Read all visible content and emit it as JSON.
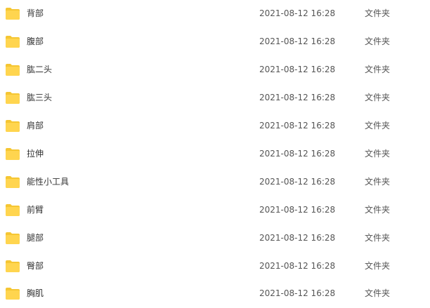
{
  "icon": {
    "name": "folder-icon",
    "color": "#FFD54F",
    "tab_color": "#F5C633"
  },
  "files": [
    {
      "name": "背部",
      "modified": "2021-08-12 16:28",
      "type": "文件夹"
    },
    {
      "name": "腹部",
      "modified": "2021-08-12 16:28",
      "type": "文件夹"
    },
    {
      "name": "肱二头",
      "modified": "2021-08-12 16:28",
      "type": "文件夹"
    },
    {
      "name": "肱三头",
      "modified": "2021-08-12 16:28",
      "type": "文件夹"
    },
    {
      "name": "肩部",
      "modified": "2021-08-12 16:28",
      "type": "文件夹"
    },
    {
      "name": "拉伸",
      "modified": "2021-08-12 16:28",
      "type": "文件夹"
    },
    {
      "name": "能性小工具",
      "modified": "2021-08-12 16:28",
      "type": "文件夹"
    },
    {
      "name": "前臂",
      "modified": "2021-08-12 16:28",
      "type": "文件夹"
    },
    {
      "name": "腿部",
      "modified": "2021-08-12 16:28",
      "type": "文件夹"
    },
    {
      "name": "臀部",
      "modified": "2021-08-12 16:28",
      "type": "文件夹"
    },
    {
      "name": "胸肌",
      "modified": "2021-08-12 16:28",
      "type": "文件夹"
    }
  ]
}
